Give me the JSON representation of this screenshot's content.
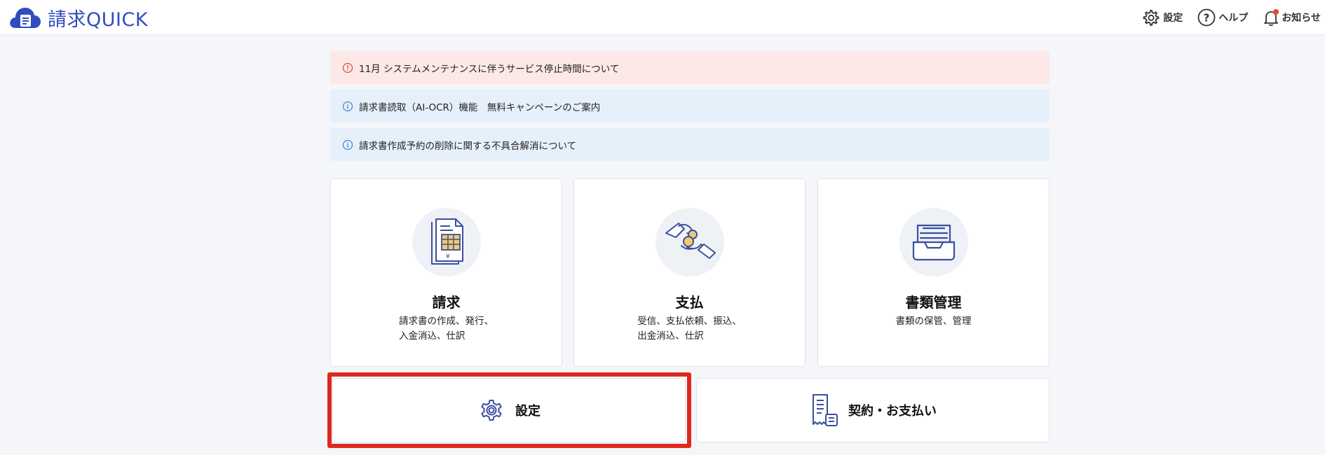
{
  "header": {
    "logo_text": "請求QUICK",
    "settings_label": "設定",
    "help_label": "ヘルプ",
    "notifications_label": "お知らせ"
  },
  "notices": [
    {
      "type": "warning",
      "text": "11月 システムメンテナンスに伴うサービス停止時間について"
    },
    {
      "type": "info",
      "text": "請求書読取（AI-OCR）機能　無料キャンペーンのご案内"
    },
    {
      "type": "info",
      "text": "請求書作成予約の削除に関する不具合解消について"
    }
  ],
  "cards": [
    {
      "title": "請求",
      "desc_line1": "請求書の作成、発行、",
      "desc_line2": "入金消込、仕訳",
      "icon": "invoice-icon"
    },
    {
      "title": "支払",
      "desc_line1": "受信、支払依頼、振込、",
      "desc_line2": "出金消込、仕訳",
      "icon": "payment-icon"
    },
    {
      "title": "書類管理",
      "desc_line1": "書類の保管、管理",
      "desc_line2": "",
      "icon": "document-tray-icon"
    }
  ],
  "buttons": {
    "settings_label": "設定",
    "contract_label": "契約・お支払い"
  },
  "colors": {
    "brand": "#2f4dbf",
    "icon_stroke": "#3b4fa0",
    "warning_bg": "#fce8e6",
    "info_bg": "#e6f0fb",
    "highlight": "#e0281c"
  }
}
